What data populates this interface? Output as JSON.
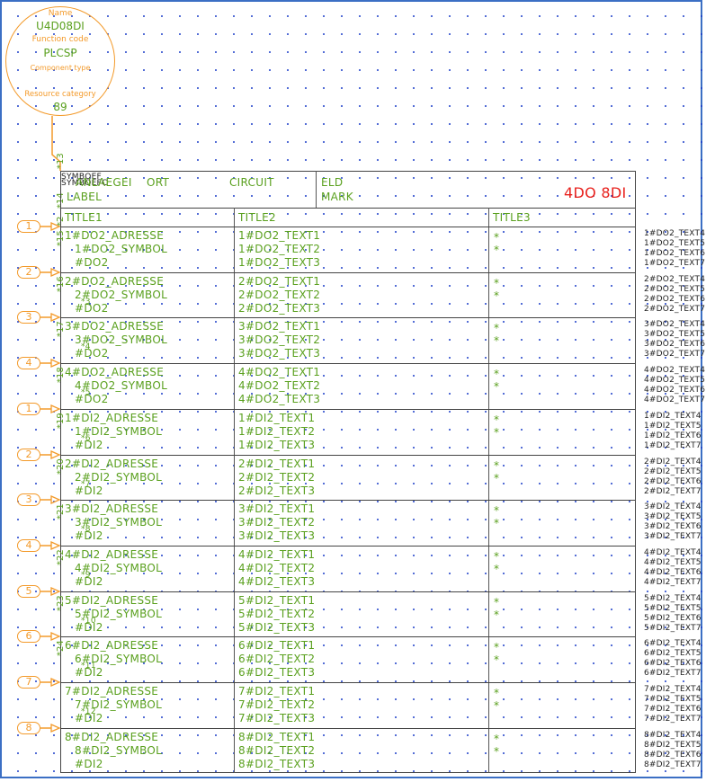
{
  "component": {
    "name_label": "Name",
    "name_value": "U4D08DI",
    "function_code_label": "Function code",
    "function_code_value": "PLCSP",
    "component_type_label": "Component type",
    "resource_category_label": "Resource category",
    "resource_category_value": "89"
  },
  "connection_labels": {
    "top": "*13",
    "header": "*14",
    "title_row": "*2"
  },
  "header": {
    "symbol_ref_1": "SYMBOEF",
    "symbol_ref_2": "SYMBOEFC",
    "anlaegg": "ANLAEGEI",
    "label": "LABEL",
    "ort": "ORT",
    "circuit": "CIRCUIT",
    "eld": "ELD",
    "mark": "MARK",
    "title": "4DO 8DI",
    "title_color": "#e8201c"
  },
  "columns": [
    "TITLE1",
    "TITLE2",
    "TITLE3"
  ],
  "rows": [
    {
      "pin": "1",
      "wire": "*15",
      "sub": "",
      "adresse": "1#DO2_ADRESSE",
      "symbol": "1#DO2_SYMBOL",
      "type": "#DO2",
      "t1": "1#DO2_TEXT1",
      "t2": "1#DO2_TEXT2",
      "t3": "1#DO2_TEXT3",
      "stars": [
        "*",
        "*"
      ],
      "ext": [
        "1#DO2_TEXT4",
        "1#DO2_TEXT5",
        "1#DO2_TEXT6",
        "1#DO2_TEXT7"
      ]
    },
    {
      "pin": "2",
      "wire": "*16",
      "sub": "*3",
      "adresse": "2#DO2_ADRESSE",
      "symbol": "2#DO2_SYMBOL",
      "type": "#DO2",
      "t1": "2#DO2_TEXT1",
      "t2": "2#DO2_TEXT2",
      "t3": "2#DO2_TEXT3",
      "stars": [
        "*",
        "*"
      ],
      "ext": [
        "2#DO2_TEXT4",
        "2#DO2_TEXT5",
        "2#DO2_TEXT6",
        "2#DO2_TEXT7"
      ]
    },
    {
      "pin": "3",
      "wire": "*17",
      "sub": "*4",
      "adresse": "3#DO2_ADRESSE",
      "symbol": "3#DO2_SYMBOL",
      "type": "#DO2",
      "t1": "3#DO2_TEXT1",
      "t2": "3#DO2_TEXT2",
      "t3": "3#DO2_TEXT3",
      "stars": [
        "*",
        "*"
      ],
      "ext": [
        "3#DO2_TEXT4",
        "3#DO2_TEXT5",
        "3#DO2_TEXT6",
        "3#DO2_TEXT7"
      ]
    },
    {
      "pin": "4",
      "wire": "*18",
      "sub": "*5",
      "adresse": "4#DO2_ADRESSE",
      "symbol": "4#DO2_SYMBOL",
      "type": "#DO2",
      "t1": "4#DO2_TEXT1",
      "t2": "4#DO2_TEXT2",
      "t3": "4#DO2_TEXT3",
      "stars": [
        "*",
        "*"
      ],
      "ext": [
        "4#DO2_TEXT4",
        "4#DO2_TEXT5",
        "4#DO2_TEXT6",
        "4#DO2_TEXT7"
      ]
    },
    {
      "pin": "1",
      "wire": "*19",
      "sub": "*6",
      "adresse": "1#DI2_ADRESSE",
      "symbol": "1#DI2_SYMBOL",
      "type": "#DI2",
      "t1": "1#DI2_TEXT1",
      "t2": "1#DI2_TEXT2",
      "t3": "1#DI2_TEXT3",
      "stars": [
        "*",
        "*"
      ],
      "ext": [
        "1#DI2_TEXT4",
        "1#DI2_TEXT5",
        "1#DI2_TEXT6",
        "1#DI2_TEXT7"
      ]
    },
    {
      "pin": "2",
      "wire": "*20",
      "sub": "*7",
      "adresse": "2#DI2_ADRESSE",
      "symbol": "2#DI2_SYMBOL",
      "type": "#DI2",
      "t1": "2#DI2_TEXT1",
      "t2": "2#DI2_TEXT2",
      "t3": "2#DI2_TEXT3",
      "stars": [
        "*",
        "*"
      ],
      "ext": [
        "2#DI2_TEXT4",
        "2#DI2_TEXT5",
        "2#DI2_TEXT6",
        "2#DI2_TEXT7"
      ]
    },
    {
      "pin": "3",
      "wire": "*21",
      "sub": "*8",
      "adresse": "3#DI2_ADRESSE",
      "symbol": "3#DI2_SYMBOL",
      "type": "#DI2",
      "t1": "3#DI2_TEXT1",
      "t2": "3#DI2_TEXT2",
      "t3": "3#DI2_TEXT3",
      "stars": [
        "*",
        "*"
      ],
      "ext": [
        "3#DI2_TEXT4",
        "3#DI2_TEXT5",
        "3#DI2_TEXT6",
        "3#DI2_TEXT7"
      ]
    },
    {
      "pin": "4",
      "wire": "*22",
      "sub": "*9",
      "adresse": "4#DI2_ADRESSE",
      "symbol": "4#DI2_SYMBOL",
      "type": "#DI2",
      "t1": "4#DI2_TEXT1",
      "t2": "4#DI2_TEXT2",
      "t3": "4#DI2_TEXT3",
      "stars": [
        "*",
        "*"
      ],
      "ext": [
        "4#DI2_TEXT4",
        "4#DI2_TEXT5",
        "4#DI2_TEXT6",
        "4#DI2_TEXT7"
      ]
    },
    {
      "pin": "5",
      "wire": "*23",
      "sub": "*10",
      "adresse": "5#DI2_ADRESSE",
      "symbol": "5#DI2_SYMBOL",
      "type": "#DI2",
      "t1": "5#DI2_TEXT1",
      "t2": "5#DI2_TEXT2",
      "t3": "5#DI2_TEXT3",
      "stars": [
        "*",
        "*"
      ],
      "ext": [
        "5#DI2_TEXT4",
        "5#DI2_TEXT5",
        "5#DI2_TEXT6",
        "5#DI2_TEXT7"
      ]
    },
    {
      "pin": "6",
      "wire": "*24",
      "sub": "*11",
      "adresse": "6#DI2_ADRESSE",
      "symbol": "6#DI2_SYMBOL",
      "type": "#DI2",
      "t1": "6#DI2_TEXT1",
      "t2": "6#DI2_TEXT2",
      "t3": "6#DI2_TEXT3",
      "stars": [
        "*",
        "*"
      ],
      "ext": [
        "6#DI2_TEXT4",
        "6#DI2_TEXT5",
        "6#DI2_TEXT6",
        "6#DI2_TEXT7"
      ]
    },
    {
      "pin": "7",
      "wire": "",
      "sub": "*12",
      "adresse": "7#DI2_ADRESSE",
      "symbol": "7#DI2_SYMBOL",
      "type": "#DI2",
      "t1": "7#DI2_TEXT1",
      "t2": "7#DI2_TEXT2",
      "t3": "7#DI2_TEXT3",
      "stars": [
        "*",
        "*"
      ],
      "ext": [
        "7#DI2_TEXT4",
        "7#DI2_TEXT5",
        "7#DI2_TEXT6",
        "7#DI2_TEXT7"
      ]
    },
    {
      "pin": "8",
      "wire": "",
      "sub": "",
      "adresse": "8#DI2_ADRESSE",
      "symbol": "8#DI2_SYMBOL",
      "type": "#DI2",
      "t1": "8#DI2_TEXT1",
      "t2": "8#DI2_TEXT2",
      "t3": "8#DI2_TEXT3",
      "stars": [
        "*",
        "*"
      ],
      "ext": [
        "8#DI2_TEXT4",
        "8#DI2_TEXT5",
        "8#DI2_TEXT6",
        "8#DI2_TEXT7"
      ]
    }
  ]
}
